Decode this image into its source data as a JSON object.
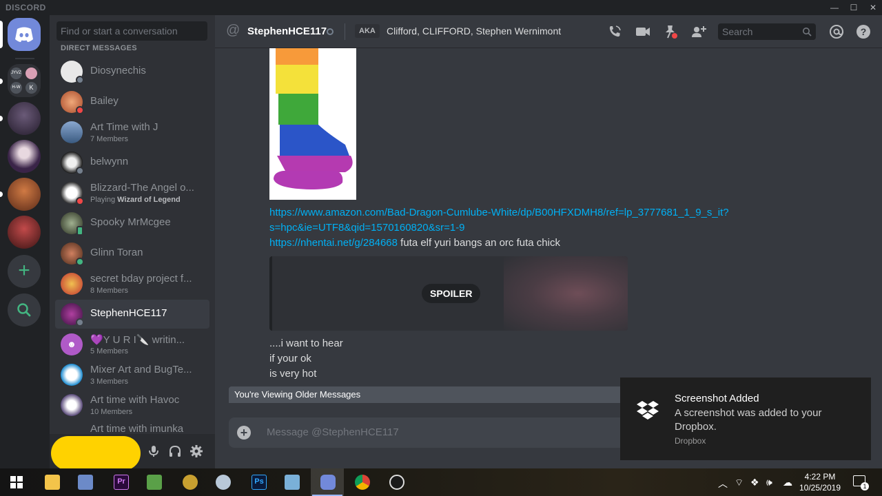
{
  "window": {
    "brand": "DISCORD",
    "controls": [
      "—",
      "☐",
      "✕"
    ]
  },
  "sidebar": {
    "search_placeholder": "Find or start a conversation",
    "section_header": "DIRECT MESSAGES",
    "dms": [
      {
        "name": "Diosynechis",
        "status": "offline"
      },
      {
        "name": "Bailey",
        "status": "dnd"
      },
      {
        "name": "Art Time with J",
        "sub": "7 Members"
      },
      {
        "name": "belwynn",
        "status": "offline"
      },
      {
        "name": "Blizzard-The Angel o...",
        "sub_prefix": "Playing ",
        "sub_game": "Wizard of Legend",
        "status": "dnd"
      },
      {
        "name": "Spooky MrMcgee",
        "status": "mobile"
      },
      {
        "name": "Glinn Toran",
        "status": "online"
      },
      {
        "name": "secret bday project f...",
        "sub": "8 Members"
      },
      {
        "name": "StephenHCE117",
        "status": "offline"
      },
      {
        "name": "💜Y U R I🔪 writin...",
        "sub": "5 Members"
      },
      {
        "name": "Mixer Art and BugTe...",
        "sub": "3 Members"
      },
      {
        "name": "Art time with Havoc",
        "sub": "10 Members"
      },
      {
        "name": "Art time with imunka",
        "sub": ""
      }
    ]
  },
  "header": {
    "title": "StephenHCE117",
    "aka_label": "AKA",
    "aka_value": "Clifford, CLIFFORD, Stephen Wernimont",
    "search_placeholder": "Search"
  },
  "messages": {
    "link1_a": "https://www.amazon.com/Bad-Dragon-Cumlube-White/dp/B00HFXDMH8/ref=lp_3777681_1_9_s_it?",
    "link1_b": "s=hpc&ie=UTF8&qid=1570160820&sr=1-9",
    "link2": "https://nhentai.net/g/284668",
    "link2_text": " futa elf yuri bangs an orc futa chick",
    "spoiler_label": "SPOILER",
    "line1": "....i want to hear",
    "line2": "if your ok",
    "line3": "is very hot"
  },
  "older_bar": "You're Viewing Older Messages",
  "composer": {
    "placeholder": "Message @StephenHCE117"
  },
  "toast": {
    "title": "Screenshot Added",
    "body": "A screenshot was added to your Dropbox.",
    "source": "Dropbox"
  },
  "taskbar": {
    "time": "4:22 PM",
    "date": "10/25/2019",
    "notification_count": "1"
  },
  "colors": {
    "blurple": "#7289da",
    "online": "#43b581",
    "dnd": "#f04747",
    "offline": "#747f8d",
    "link": "#00b0f4"
  }
}
